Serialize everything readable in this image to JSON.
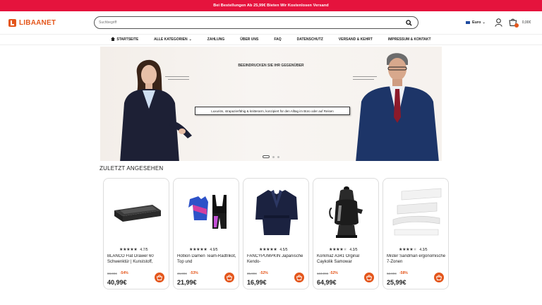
{
  "promo": {
    "text": "Bei Bestellungen Ab 25,99€ Bieten Wir Kostenlosen Versand"
  },
  "brand": {
    "name": "LIBAANET",
    "accent": "#e4561b",
    "promo_bg": "#e5133d"
  },
  "search": {
    "placeholder": "Suchbegriff"
  },
  "header": {
    "currency": "Euro",
    "cart_total": "0,00€"
  },
  "nav": {
    "items": [
      "STARTSEITE",
      "ALLE KATEGORIEN",
      "ZAHLUNG",
      "ÜBER UNS",
      "FAQ",
      "DATENSCHUTZ",
      "VERSAND & KEHRT",
      "IMPRESSUM & KONTAKT"
    ]
  },
  "hero": {
    "kicker": "BEEINDRUCKEN SIE IHR GEGENÜBER",
    "caption": "Luxuriös, strapazierfähig & knitterarm, konzipiert für den Alltag im Büro oder auf Reisen"
  },
  "recent": {
    "title": "ZULETZT ANGESEHEN",
    "products": [
      {
        "title": "BLANCO Flat Drawer 60 Schwenktür | Kunststoff,",
        "rating": "4.7/5",
        "stars": 5,
        "old_price": "88,99€",
        "discount": "-54%",
        "price": "40,99€",
        "image": "drawer"
      },
      {
        "title": "Hotlion Damen Team-Radtrikot, Top und",
        "rating": "4.9/5",
        "stars": 5,
        "old_price": "46,99€",
        "discount": "-53%",
        "price": "21,99€",
        "image": "cycling-kit"
      },
      {
        "title": "FANCYPUMPKIN Japanische Kendo-",
        "rating": "4.5/5",
        "stars": 5,
        "old_price": "35,99€",
        "discount": "-52%",
        "price": "16,99€",
        "image": "kendo-jacket"
      },
      {
        "title": "Korkmaz A341 Orginal Caykolik Samowar",
        "rating": "4.3/5",
        "stars": 4,
        "old_price": "134,99€",
        "discount": "-52%",
        "price": "64,99€",
        "image": "samovar"
      },
      {
        "title": "Mister Sandman ergonomische 7-Zonen",
        "rating": "4.3/5",
        "stars": 4,
        "old_price": "62,99€",
        "discount": "-58%",
        "price": "25,99€",
        "image": "mattress"
      }
    ]
  }
}
